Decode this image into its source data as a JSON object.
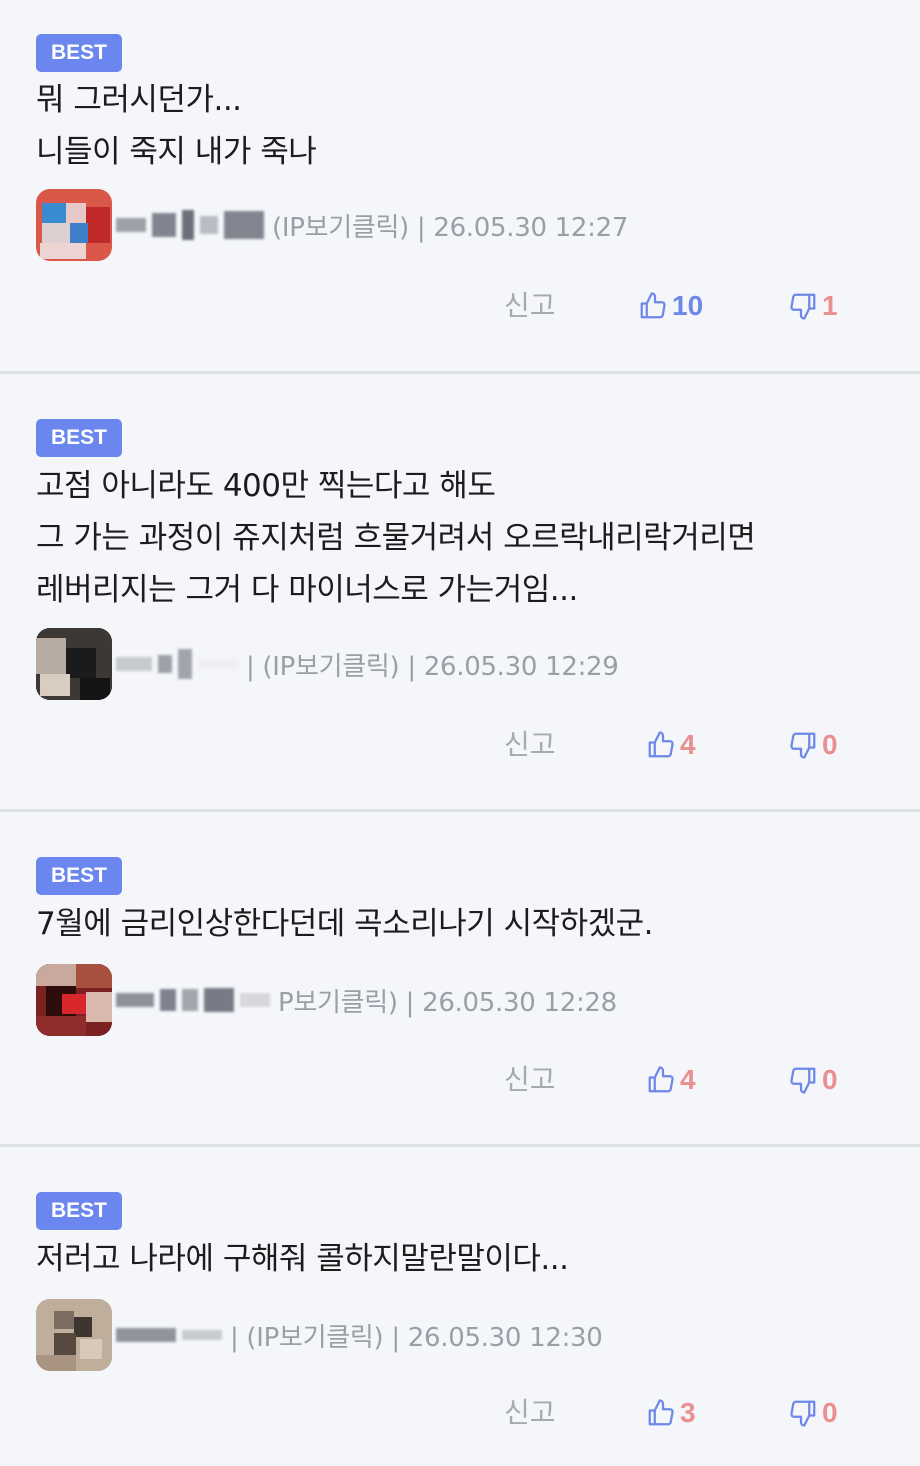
{
  "comments": [
    {
      "badge": "BEST",
      "lines": [
        "뭐 그러시던가...",
        "니들이 죽지 내가 죽나"
      ],
      "ip_label": "(IP보기클릭)",
      "separator": "|",
      "timestamp": "26.05.30 12:27",
      "report_label": "신고",
      "likes": "10",
      "dislikes": "1"
    },
    {
      "badge": "BEST",
      "lines": [
        "고점 아니라도 400만 찍는다고 해도",
        "그 가는 과정이 쥬지처럼 흐물거려서 오르락내리락거리면",
        "레버리지는 그거 다 마이너스로 가는거임..."
      ],
      "ip_label": "| (IP보기클릭)",
      "separator": "|",
      "timestamp": "26.05.30 12:29",
      "report_label": "신고",
      "likes": "4",
      "dislikes": "0"
    },
    {
      "badge": "BEST",
      "lines": [
        "7월에 금리인상한다던데 곡소리나기 시작하겠군."
      ],
      "ip_label": "P보기클릭)",
      "separator": "|",
      "timestamp": "26.05.30 12:28",
      "report_label": "신고",
      "likes": "4",
      "dislikes": "0"
    },
    {
      "badge": "BEST",
      "lines": [
        "저러고 나라에 구해줘 콜하지말란말이다..."
      ],
      "ip_label": "| (IP보기클릭)",
      "separator": "|",
      "timestamp": "26.05.30 12:30",
      "report_label": "신고",
      "likes": "3",
      "dislikes": "0"
    }
  ],
  "colors": {
    "badge": "#6b86ef",
    "like": "#6d88e8",
    "dislike": "#ea8f8f",
    "meta_text": "#9a9ea6",
    "background": "#f4f6fa"
  },
  "icons": {
    "like": "thumbs-up-icon",
    "dislike": "thumbs-down-icon"
  }
}
